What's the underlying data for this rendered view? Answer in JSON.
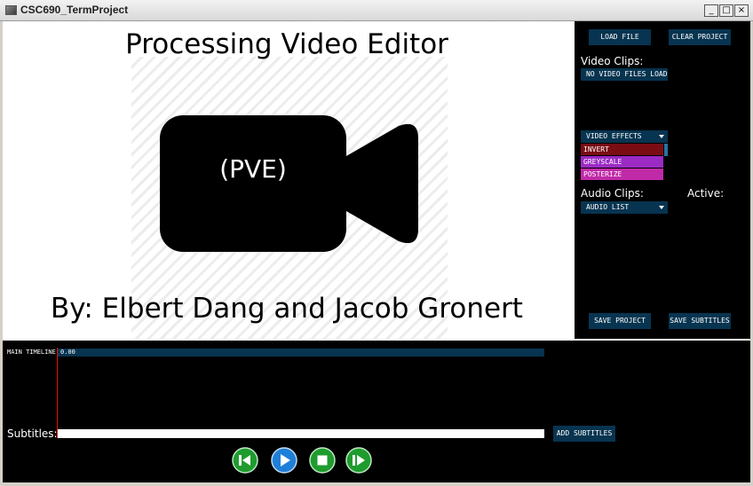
{
  "window": {
    "title": "CSC690_TermProject",
    "minimize_glyph": "_",
    "maximize_glyph": "□",
    "close_glyph": "×"
  },
  "preview": {
    "heading": "Processing Video Editor",
    "logo_text": "(PVE)",
    "byline": "By: Elbert Dang and Jacob Gronert",
    "icon": "video-camera-icon"
  },
  "side_panel": {
    "load_file": "LOAD FILE",
    "clear_project": "CLEAR PROJECT",
    "video_clips_label": "Video Clips:",
    "video_clips_dropdown": "NO VIDEO FILES LOADED",
    "video_effects_dropdown": "VIDEO EFFECTS",
    "effects": [
      {
        "label": "INVERT",
        "color": "#7a0c14"
      },
      {
        "label": "GREYSCALE",
        "color": "#9b2bc4"
      },
      {
        "label": "POSTERIZE",
        "color": "#c02aa8"
      }
    ],
    "audio_clips_label": "Audio Clips:",
    "active_label": "Active:",
    "audio_list_dropdown": "AUDIO LIST",
    "save_project": "SAVE PROJECT",
    "save_subtitles": "SAVE SUBTITLES"
  },
  "timeline": {
    "label": "MAIN TIMELINE",
    "time": "0.00"
  },
  "subtitles": {
    "label": "Subtitles:",
    "value": "",
    "add_button": "ADD SUBTITLES"
  },
  "controls": [
    {
      "name": "rewind-icon",
      "color": "#1f9c2e"
    },
    {
      "name": "play-icon",
      "color": "#1e7fd8"
    },
    {
      "name": "stop-icon",
      "color": "#1f9c2e"
    },
    {
      "name": "fast-forward-icon",
      "color": "#1f9c2e"
    }
  ],
  "colors": {
    "panel_button": "#073450",
    "accent_scroll": "#2a72a4",
    "playhead": "#e01010"
  }
}
